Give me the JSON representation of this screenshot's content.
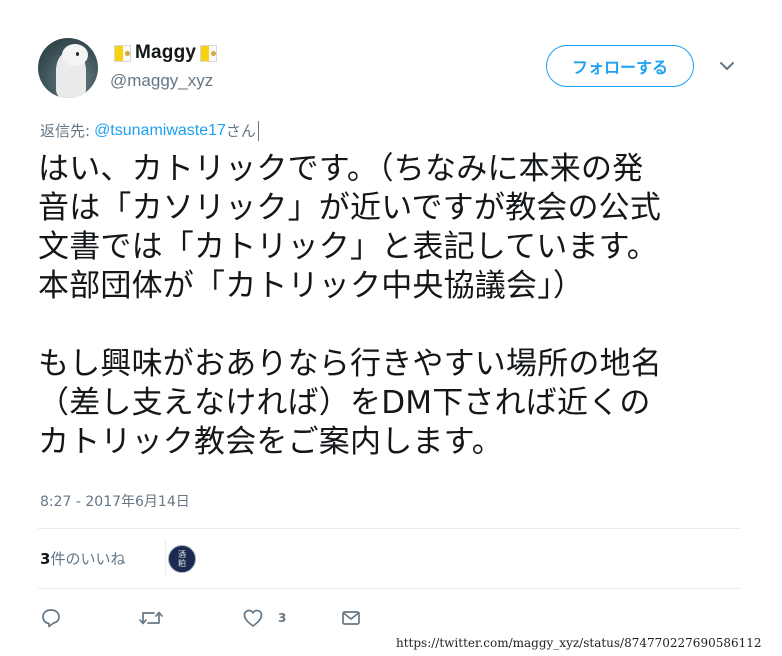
{
  "author": {
    "display_name": "Maggy",
    "handle": "@maggy_xyz",
    "flag_icon": "vatican-flag-icon"
  },
  "follow_button_label": "フォローする",
  "reply_to": {
    "prefix": "返信先:",
    "mention": "@tsunamiwaste17",
    "suffix": "さん"
  },
  "tweet": {
    "lines": [
      "はい、カトリックです。（ちなみに本来の発",
      "音は「カソリック」が近いですが教会の公式",
      "文書では「カトリック」と表記しています。",
      "本部団体が「カトリック中央協議会」）",
      "",
      "もし興味がおありなら行きやすい場所の地名",
      "（差し支えなければ）をDM下されば近くの",
      "カトリック教会をご案内します。"
    ],
    "timestamp": "8:27 - 2017年6月14日"
  },
  "likes": {
    "count": "3",
    "label": "件のいいね",
    "liker_avatar_text": [
      "酒",
      "粕"
    ]
  },
  "actions": {
    "reply_icon": "reply-icon",
    "retweet_icon": "retweet-icon",
    "like_icon": "heart-icon",
    "like_count": "3",
    "dm_icon": "envelope-icon"
  },
  "source_url": "https://twitter.com/maggy_xyz/status/874770227690586112",
  "colors": {
    "accent": "#1da1f2",
    "text": "#14171a",
    "muted": "#657786",
    "divider": "#e6ecf0"
  }
}
